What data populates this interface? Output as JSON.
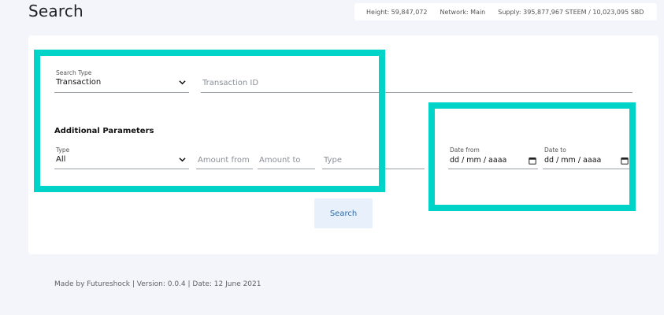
{
  "page": {
    "title": "Search"
  },
  "stats": {
    "height": "Height: 59,847,072",
    "network": "Network: Main",
    "supply": "Supply: 395,877,967 STEEM / 10,023,095 SBD"
  },
  "form": {
    "search_type": {
      "label": "Search Type",
      "value": "Transaction"
    },
    "transaction_id": {
      "placeholder": "Transaction ID"
    },
    "additional_title": "Additional Parameters",
    "type_select": {
      "label": "Type",
      "value": "All"
    },
    "amount_from": {
      "placeholder": "Amount from"
    },
    "amount_to": {
      "placeholder": "Amount to"
    },
    "type_text": {
      "placeholder": "Type"
    },
    "date_from": {
      "label": "Date from",
      "value": "dd / mm / aaaa"
    },
    "date_to": {
      "label": "Date to",
      "value": "dd / mm / aaaa"
    },
    "search_button": "Search"
  },
  "footer": {
    "text": "Made by Futureshock |  Version: 0.0.4 | Date: 12 June 2021"
  },
  "colors": {
    "highlight": "#00d3c8",
    "button_bg": "#e8f1fb",
    "button_text": "#2d6aa6"
  }
}
